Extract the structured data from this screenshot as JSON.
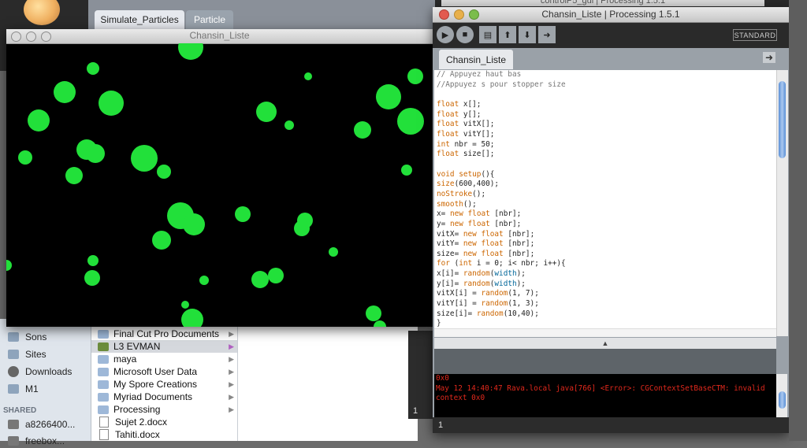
{
  "background": {
    "tabs": [
      "Simulate_Particles",
      "Particle"
    ],
    "title_fragment": "controlP5_gui | Processing 1.5.1"
  },
  "finder": {
    "sidebar": [
      {
        "label": "Sons",
        "icon": "folder-icon"
      },
      {
        "label": "Sites",
        "icon": "folder-icon"
      },
      {
        "label": "Downloads",
        "icon": "download-icon"
      },
      {
        "label": "M1",
        "icon": "folder-icon"
      }
    ],
    "shared_header": "SHARED",
    "shared_items": [
      "a8266400...",
      "freebox..."
    ],
    "column_items": [
      {
        "label": "Final Cut Pro Documents",
        "type": "folder"
      },
      {
        "label": "L3 EVMAN",
        "type": "folder",
        "selected": true
      },
      {
        "label": "maya",
        "type": "folder"
      },
      {
        "label": "Microsoft User Data",
        "type": "folder"
      },
      {
        "label": "My Spore Creations",
        "type": "folder"
      },
      {
        "label": "Myriad Documents",
        "type": "folder"
      },
      {
        "label": "Processing",
        "type": "folder"
      },
      {
        "label": "Sujet 2.docx",
        "type": "doc"
      },
      {
        "label": "Tahiti.docx",
        "type": "doc"
      }
    ]
  },
  "sketch": {
    "title": "Chansin_Liste",
    "background_color": "#000000",
    "particle_color": "#22e03a"
  },
  "editor": {
    "title": "Chansin_Liste | Processing 1.5.1",
    "mode": "STANDARD",
    "tab": "Chansin_Liste",
    "toolbar": [
      "run-icon",
      "stop-icon",
      "new-icon",
      "open-icon",
      "save-icon",
      "export-icon"
    ],
    "code_lines": [
      "// Appuyez haut bas",
      "//Appuyez s pour stopper size",
      "",
      "float x[];",
      "float y[];",
      "float vitX[];",
      "float vitY[];",
      "int nbr = 50;",
      "float size[];",
      "",
      "void setup(){",
      "size(600,400);",
      "noStroke();",
      "smooth();",
      "x= new float [nbr];",
      "y= new float [nbr];",
      "vitX= new float [nbr];",
      "vitY= new float [nbr];",
      "size= new float [nbr];",
      "for (int i = 0; i< nbr; i++){",
      "x[i]= random(width);",
      "y[i]= random(width);",
      "vitX[i] = random(1, 7);",
      "vitY[i] = random(1, 3);",
      "size[i]= random(10,40);",
      "}"
    ],
    "console_lines": [
      "0x0",
      "May 12 14:40:47 Rava.local java[766] <Error>: CGContextSetBaseCTM: invalid",
      "context 0x0"
    ],
    "line_number": "1",
    "bg_line_number": "1",
    "colors": {
      "keyword": "#cc6600",
      "function": "#006699",
      "comment": "#777777",
      "error": "#e0281c"
    }
  }
}
